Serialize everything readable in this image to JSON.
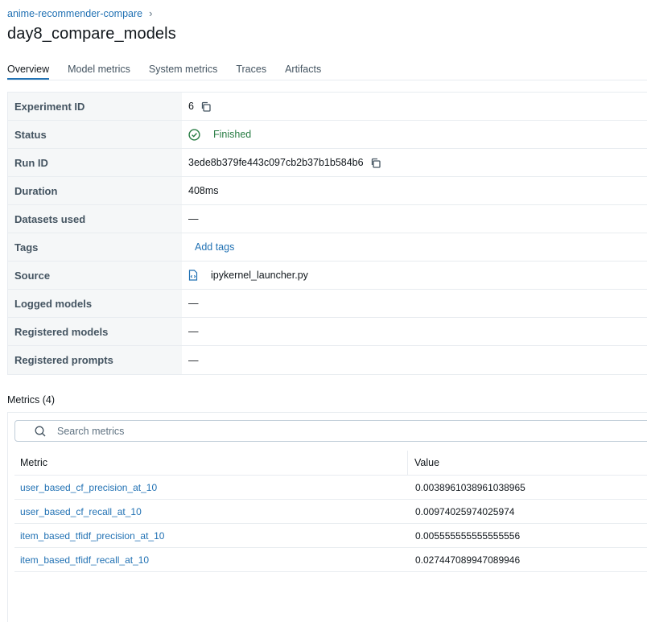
{
  "breadcrumb": {
    "experiment": "anime-recommender-compare",
    "separator": "›"
  },
  "title": "day8_compare_models",
  "tabs": [
    {
      "label": "Overview",
      "active": true
    },
    {
      "label": "Model metrics"
    },
    {
      "label": "System metrics"
    },
    {
      "label": "Traces"
    },
    {
      "label": "Artifacts"
    }
  ],
  "details": {
    "experiment_id": {
      "label": "Experiment ID",
      "value": "6"
    },
    "status": {
      "label": "Status",
      "value": "Finished"
    },
    "run_id": {
      "label": "Run ID",
      "value": "3ede8b379fe443c097cb2b37b1b584b6"
    },
    "duration": {
      "label": "Duration",
      "value": "408ms"
    },
    "datasets": {
      "label": "Datasets used",
      "value": "—"
    },
    "tags": {
      "label": "Tags",
      "value": "Add tags"
    },
    "source": {
      "label": "Source",
      "value": "ipykernel_launcher.py"
    },
    "logged_models": {
      "label": "Logged models",
      "value": "—"
    },
    "registered_models": {
      "label": "Registered models",
      "value": "—"
    },
    "registered_prompts": {
      "label": "Registered prompts",
      "value": "—"
    }
  },
  "metrics": {
    "title": "Metrics (4)",
    "search_placeholder": "Search metrics",
    "columns": {
      "metric": "Metric",
      "value": "Value"
    },
    "rows": [
      {
        "name": "user_based_cf_precision_at_10",
        "value": "0.0038961038961038965"
      },
      {
        "name": "user_based_cf_recall_at_10",
        "value": "0.00974025974025974"
      },
      {
        "name": "item_based_tfidf_precision_at_10",
        "value": "0.005555555555555556"
      },
      {
        "name": "item_based_tfidf_recall_at_10",
        "value": "0.027447089947089946"
      }
    ]
  },
  "colors": {
    "link": "#2272b4",
    "success": "#277c43",
    "text": "#11171c",
    "muted": "#445461",
    "key_bg": "#f5f7f8"
  },
  "icons": {
    "copy": "copy-icon",
    "status": "check-circle-icon",
    "source": "file-code-icon",
    "search": "search-icon"
  }
}
